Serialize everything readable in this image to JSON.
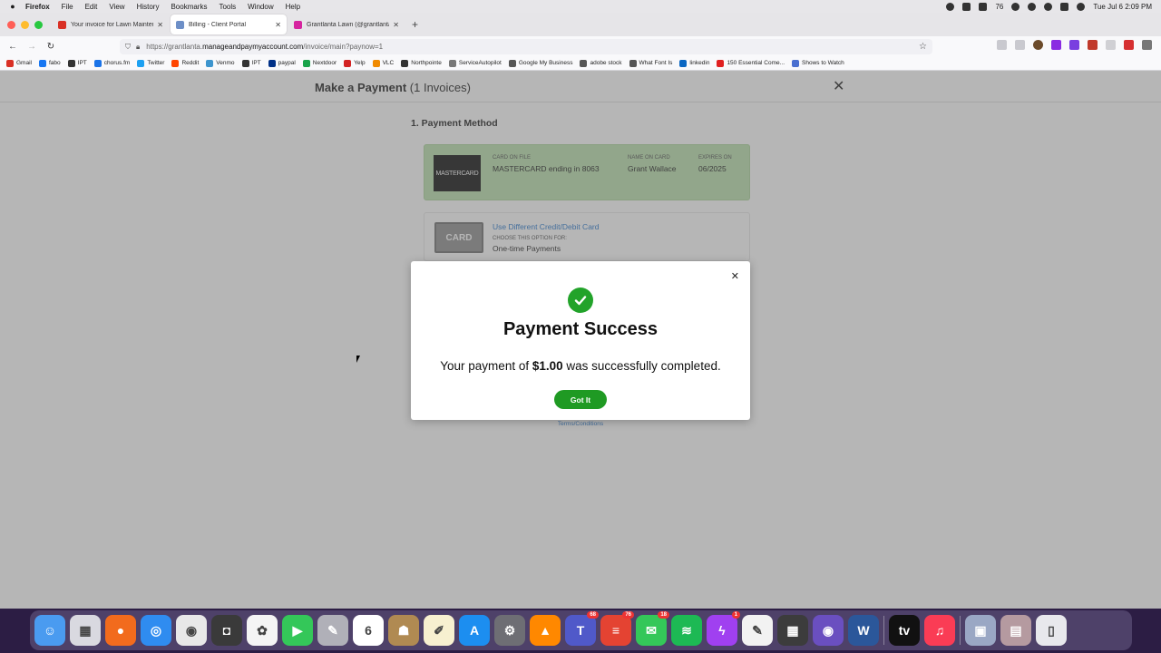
{
  "menubar": {
    "items": [
      "Firefox",
      "File",
      "Edit",
      "View",
      "History",
      "Bookmarks",
      "Tools",
      "Window",
      "Help"
    ],
    "battery_or_count": "76",
    "clock": "Tue Jul 6  2:09 PM"
  },
  "tabs": [
    {
      "label": "Your invoice for Lawn Maintenance",
      "color": "#d93025"
    },
    {
      "label": "Billing - Client Portal",
      "color": "#6d8fc7"
    },
    {
      "label": "Grantlanta Lawn (@grantlantalawn)",
      "color": "#d6249f"
    }
  ],
  "url": {
    "prefix": "https://grantlanta.",
    "domain": "manageandpaymyaccount.com",
    "path": "/invoice/main?paynow=1"
  },
  "bookmarks": [
    {
      "label": "Gmail",
      "color": "#d93025"
    },
    {
      "label": "fabo",
      "color": "#1877f2"
    },
    {
      "label": "IPT",
      "color": "#333333"
    },
    {
      "label": "chorus.fm",
      "color": "#1a73e8"
    },
    {
      "label": "Twitter",
      "color": "#1da1f2"
    },
    {
      "label": "Reddit",
      "color": "#ff4500"
    },
    {
      "label": "Venmo",
      "color": "#3d95ce"
    },
    {
      "label": "IPT",
      "color": "#333333"
    },
    {
      "label": "paypal",
      "color": "#003087"
    },
    {
      "label": "Nextdoor",
      "color": "#19a34a"
    },
    {
      "label": "Yelp",
      "color": "#d32323"
    },
    {
      "label": "VLC",
      "color": "#f08a00"
    },
    {
      "label": "Northpointe",
      "color": "#333333"
    },
    {
      "label": "ServiceAutopilot",
      "color": "#777777"
    },
    {
      "label": "Google My Business",
      "color": "#555555"
    },
    {
      "label": "adobe stock",
      "color": "#555555"
    },
    {
      "label": "What Font Is",
      "color": "#555555"
    },
    {
      "label": "linkedin",
      "color": "#0a66c2"
    },
    {
      "label": "150 Essential Come...",
      "color": "#e02020"
    },
    {
      "label": "Shows to Watch",
      "color": "#4a6fd0"
    }
  ],
  "page": {
    "title_strong": "Make a Payment",
    "title_rest": " (1 Invoices)",
    "section_title": "1. Payment Method",
    "card_on_file": {
      "badge": "MASTERCARD",
      "label_card": "CARD ON FILE",
      "value_card": "MASTERCARD ending in 8063",
      "label_name": "NAME ON CARD",
      "value_name": "Grant Wallace",
      "label_expires": "EXPIRES ON",
      "value_expires": "06/2025"
    },
    "alt_card": {
      "badge": "CARD",
      "link": "Use Different Credit/Debit Card",
      "label": "CHOOSE THIS OPTION FOR:",
      "value": "One-time Payments"
    },
    "terms": "Terms/Conditions"
  },
  "modal": {
    "title": "Payment Success",
    "msg_before": "Your payment of ",
    "amount": "$1.00",
    "msg_after": " was successfully completed.",
    "button": "Got It"
  },
  "dock": [
    {
      "name": "finder",
      "color": "#4a9bf0",
      "glyph": "☺"
    },
    {
      "name": "launchpad",
      "color": "#d9d9e0",
      "glyph": "▦"
    },
    {
      "name": "firefox",
      "color": "#f26b1d",
      "glyph": "●"
    },
    {
      "name": "safari",
      "color": "#2f8cf0",
      "glyph": "◎"
    },
    {
      "name": "chrome",
      "color": "#e8e8e8",
      "glyph": "◉"
    },
    {
      "name": "screenshot",
      "color": "#3a3a3a",
      "glyph": "◘"
    },
    {
      "name": "photos",
      "color": "#f4f4f4",
      "glyph": "✿"
    },
    {
      "name": "facetime",
      "color": "#34c759",
      "glyph": "▶"
    },
    {
      "name": "preview",
      "color": "#b0b0b8",
      "glyph": "✎"
    },
    {
      "name": "calendar",
      "color": "#ffffff",
      "glyph": "6"
    },
    {
      "name": "contacts",
      "color": "#b08a52",
      "glyph": "☗"
    },
    {
      "name": "notes",
      "color": "#f7f0d0",
      "glyph": "✐"
    },
    {
      "name": "app-store",
      "color": "#1c8ef0",
      "glyph": "A"
    },
    {
      "name": "system-preferences",
      "color": "#6e6e74",
      "glyph": "⚙"
    },
    {
      "name": "vlc",
      "color": "#ff8800",
      "glyph": "▲"
    },
    {
      "name": "teams",
      "color": "#5059c9",
      "glyph": "T",
      "badge": "68"
    },
    {
      "name": "todoist",
      "color": "#e44332",
      "glyph": "≡",
      "badge": "76"
    },
    {
      "name": "messages",
      "color": "#34c759",
      "glyph": "✉",
      "badge": "18"
    },
    {
      "name": "spotify",
      "color": "#1db954",
      "glyph": "≋"
    },
    {
      "name": "messenger",
      "color": "#a040f0",
      "glyph": "ϟ",
      "badge": "1"
    },
    {
      "name": "textedit",
      "color": "#f2f2f2",
      "glyph": "✎"
    },
    {
      "name": "calculator",
      "color": "#3c3c3c",
      "glyph": "▦"
    },
    {
      "name": "alien-app",
      "color": "#6a4fc0",
      "glyph": "◉"
    },
    {
      "name": "word",
      "color": "#2b579a",
      "glyph": "W"
    },
    {
      "name": "apple-tv",
      "color": "#111111",
      "glyph": "tv"
    },
    {
      "name": "music",
      "color": "#fa3c55",
      "glyph": "♫"
    },
    {
      "name": "image-viewer",
      "color": "#9aa7c4",
      "glyph": "▣"
    },
    {
      "name": "downloads-stack",
      "color": "#b59aa0",
      "glyph": "▤"
    },
    {
      "name": "trash",
      "color": "#e8e8ec",
      "glyph": "▯"
    }
  ]
}
